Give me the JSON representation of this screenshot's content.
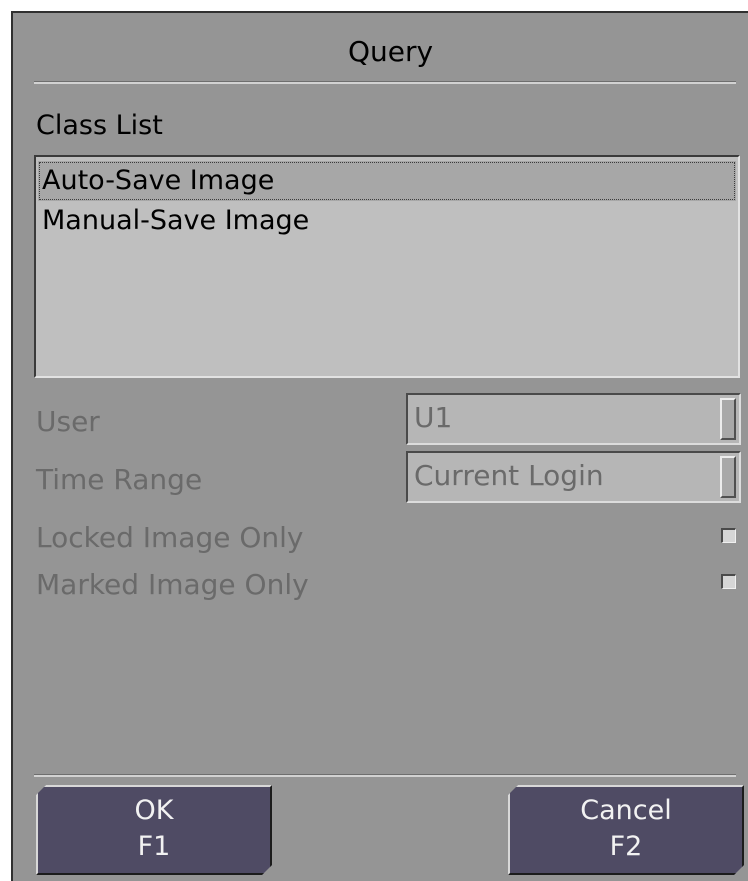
{
  "dialog": {
    "title": "Query"
  },
  "class_list": {
    "label": "Class List",
    "items": [
      {
        "label": "Auto-Save Image",
        "selected": true
      },
      {
        "label": "Manual-Save Image",
        "selected": false
      }
    ]
  },
  "fields": {
    "user": {
      "label": "User",
      "value": "U1"
    },
    "time_range": {
      "label": "Time Range",
      "value": "Current Login"
    },
    "locked_only": {
      "label": "Locked Image Only",
      "checked": false
    },
    "marked_only": {
      "label": "Marked Image Only",
      "checked": false
    }
  },
  "buttons": {
    "ok": {
      "label": "OK",
      "key": "F1"
    },
    "cancel": {
      "label": "Cancel",
      "key": "F2"
    }
  },
  "colors": {
    "dialog_bg": "#959595",
    "button_bg": "#4f4b64",
    "disabled_text": "#6a6a6a"
  }
}
